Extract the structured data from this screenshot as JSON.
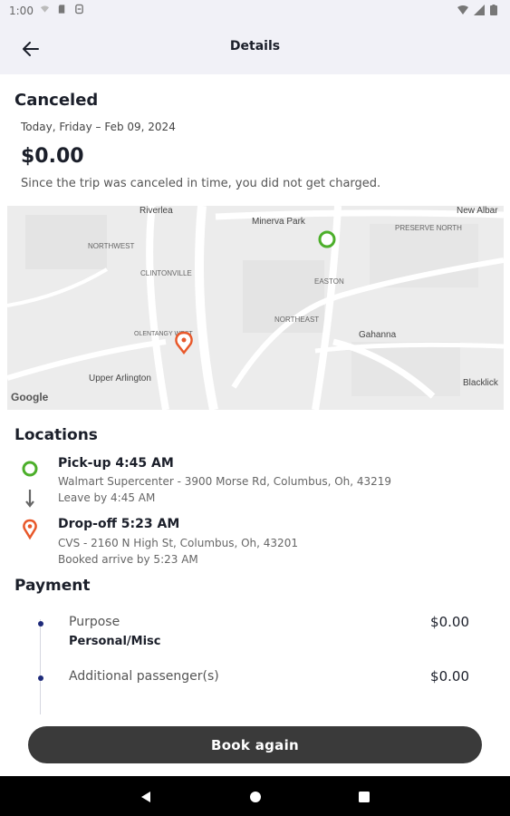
{
  "status_bar": {
    "time": "1:00"
  },
  "header": {
    "title": "Details"
  },
  "trip": {
    "status": "Canceled",
    "date": "Today, Friday – Feb 09, 2024",
    "amount": "$0.00",
    "notice": "Since the trip was canceled in time, you did not get charged."
  },
  "map": {
    "labels": [
      "Riverlea",
      "Minerva Park",
      "New Albar",
      "NORTHWEST",
      "PRESERVE NORTH",
      "CLINTONVILLE",
      "EASTON",
      "NORTHEAST",
      "OLENTANGY WEST",
      "Gahanna",
      "Upper Arlington",
      "Blacklick",
      "Google"
    ]
  },
  "locations": {
    "title": "Locations",
    "pickup": {
      "title": "Pick-up 4:45 AM",
      "address": "Walmart Supercenter - 3900 Morse Rd, Columbus, Oh, 43219",
      "note": "Leave by 4:45 AM"
    },
    "dropoff": {
      "title": "Drop-off 5:23 AM",
      "address": "CVS - 2160 N High St, Columbus, Oh, 43201",
      "note": "Booked arrive by 5:23 AM"
    }
  },
  "payment": {
    "title": "Payment",
    "items": [
      {
        "label": "Purpose",
        "value": "$0.00",
        "detail": "Personal/Misc"
      },
      {
        "label": "Additional passenger(s)",
        "value": "$0.00"
      }
    ]
  },
  "actions": {
    "book_again": "Book again"
  },
  "colors": {
    "pickup": "#4caf2a",
    "dropoff": "#e8582a",
    "accent": "#1e2a7a",
    "button": "#3a3a3a"
  }
}
